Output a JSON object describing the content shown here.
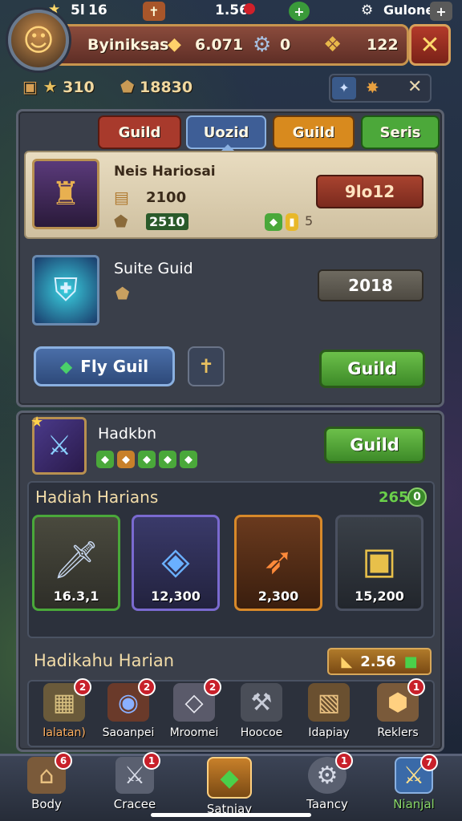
{
  "status_bar": {
    "left_icon": "star-icon",
    "text_a": "5l",
    "text_b": "16",
    "center_value": "1.56",
    "right_label": "Gulone"
  },
  "header": {
    "player_name": "Byiniksas",
    "gold_value": "6.071",
    "gear_value": "0",
    "gem_value": "122",
    "row2_a": "310",
    "row2_b": "18830"
  },
  "tabs": [
    {
      "label": "Guild",
      "color": "#a83a2c"
    },
    {
      "label": "Uozid",
      "color": "#3e5e96"
    },
    {
      "label": "Guild",
      "color": "#d88a1e"
    },
    {
      "label": "Seris",
      "color": "#4ca83a"
    }
  ],
  "guild_card": {
    "name": "Neis Hariosai",
    "gold": "2100",
    "power": "2510",
    "mini": "5",
    "button": "9lo12"
  },
  "suite_card": {
    "name": "Suite Guid",
    "button": "2018"
  },
  "actions": {
    "fly_guild": "Fly Guil",
    "guild_btn": "Guild"
  },
  "hero_row": {
    "name": "Hadkbn",
    "guild_btn": "Guild"
  },
  "daily": {
    "title": "Hadiah Harians",
    "count": "265",
    "count_badge": "0",
    "rewards": [
      {
        "icon": "sword-icon",
        "value": "16.3,1",
        "border": "#4aa83a"
      },
      {
        "icon": "crystal-cube-icon",
        "value": "12,300",
        "border": "#7a6ad0"
      },
      {
        "icon": "fire-spear-icon",
        "value": "2,300",
        "border": "#d8892a"
      },
      {
        "icon": "treasure-chest-icon",
        "value": "15,200",
        "border": "#4a5060"
      }
    ]
  },
  "second_daily": {
    "title": "Hadikahu Harian",
    "value": "2.56"
  },
  "bag": [
    {
      "label": "Ialatan)",
      "badge": "2"
    },
    {
      "label": "Saoanpei",
      "badge": "2"
    },
    {
      "label": "Mroomei",
      "badge": "2"
    },
    {
      "label": "Hoocoe",
      "badge": ""
    },
    {
      "label": "Idapiay",
      "badge": ""
    },
    {
      "label": "Reklers",
      "badge": "1"
    }
  ],
  "nav": [
    {
      "label": "Body",
      "badge": "6"
    },
    {
      "label": "Cracee",
      "badge": "1"
    },
    {
      "label": "Satniay",
      "badge": ""
    },
    {
      "label": "Taancy",
      "badge": "1"
    },
    {
      "label": "Nianjal",
      "badge": "7"
    }
  ]
}
